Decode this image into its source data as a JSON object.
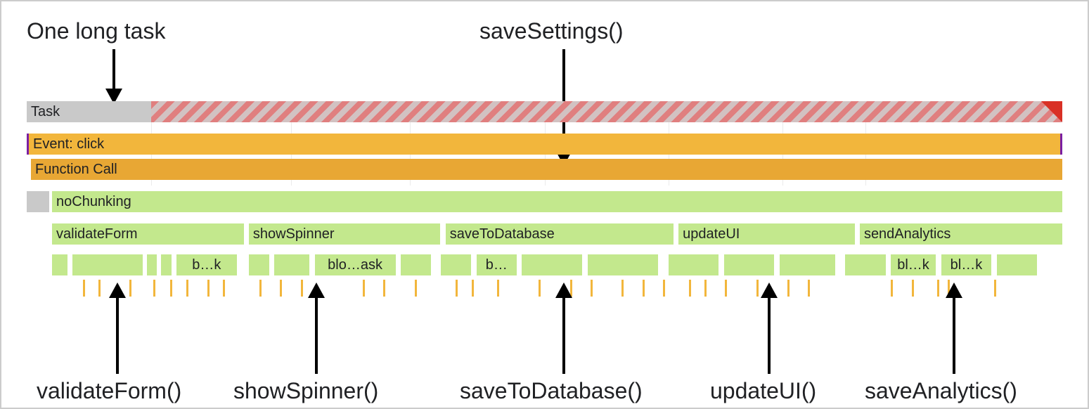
{
  "annotations": {
    "top_left": "One long task",
    "top_right": "saveSettings()",
    "bottom_1": "validateForm()",
    "bottom_2": "showSpinner()",
    "bottom_3": "saveToDatabase()",
    "bottom_4": "updateUI()",
    "bottom_5": "saveAnalytics()"
  },
  "flame": {
    "task_label": "Task",
    "event_label": "Event: click",
    "function_call_label": "Function Call",
    "nochunking_label": "noChunking",
    "functions": {
      "f1": "validateForm",
      "f2": "showSpinner",
      "f3": "saveToDatabase",
      "f4": "updateUI",
      "f5": "sendAnalytics"
    },
    "subblocks": {
      "b1": "b…k",
      "b2": "blo…ask",
      "b3": "b…",
      "b4": "bl…k",
      "b5": "bl…k"
    }
  }
}
